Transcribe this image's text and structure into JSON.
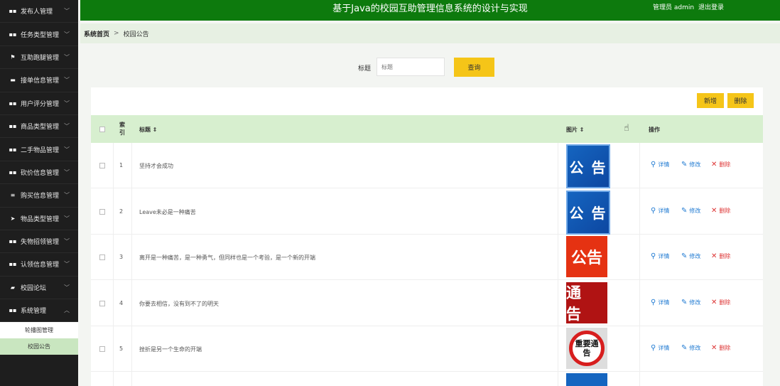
{
  "header": {
    "title": "基于Java的校园互助管理信息系统的设计与实现",
    "user": "管理员 admin",
    "logout": "退出登录"
  },
  "sidebar": {
    "items": [
      {
        "label": "发布人管理",
        "icon": "grid-icon",
        "glyph": "▪▪"
      },
      {
        "label": "任务类型管理",
        "icon": "grid-icon",
        "glyph": "▪▪"
      },
      {
        "label": "互助跑腿管理",
        "icon": "flag-icon",
        "glyph": "⚑"
      },
      {
        "label": "接单信息管理",
        "icon": "ticket-icon",
        "glyph": "▬"
      },
      {
        "label": "用户评分管理",
        "icon": "grid-icon",
        "glyph": "▪▪"
      },
      {
        "label": "商品类型管理",
        "icon": "grid-icon",
        "glyph": "▪▪"
      },
      {
        "label": "二手物品管理",
        "icon": "grid-icon",
        "glyph": "▪▪"
      },
      {
        "label": "砍价信息管理",
        "icon": "grid-icon",
        "glyph": "▪▪"
      },
      {
        "label": "购买信息管理",
        "icon": "list-icon",
        "glyph": "≡"
      },
      {
        "label": "物品类型管理",
        "icon": "send-icon",
        "glyph": "➤"
      },
      {
        "label": "失物招领管理",
        "icon": "grid-icon",
        "glyph": "▪▪"
      },
      {
        "label": "认领信息管理",
        "icon": "grid-icon",
        "glyph": "▪▪"
      },
      {
        "label": "校园论坛",
        "icon": "chat-icon",
        "glyph": "▰"
      },
      {
        "label": "系统管理",
        "icon": "grid-icon",
        "glyph": "▪▪",
        "expanded": true
      }
    ],
    "sub_items": [
      {
        "label": "轮播图管理"
      },
      {
        "label": "校园公告",
        "active": true
      }
    ]
  },
  "breadcrumb": {
    "home": "系统首页",
    "separator": ">",
    "current": "校园公告"
  },
  "search": {
    "label": "标题",
    "placeholder": "标题",
    "button": "查询"
  },
  "toolbar": {
    "add": "新增",
    "delete": "删除"
  },
  "table": {
    "headers": {
      "index": "索引",
      "title": "标题 ⇕",
      "image": "图片 ⇕",
      "actions": "操作"
    },
    "rows": [
      {
        "index": "1",
        "title": "坚持才会成功",
        "image_text": "公 告",
        "image_style": "blue"
      },
      {
        "index": "2",
        "title": "Leave未必是一种痛苦",
        "image_text": "公 告",
        "image_style": "blue"
      },
      {
        "index": "3",
        "title": "离开是一种痛苦，是一种勇气，但同样也是一个考验，是一个新的开端",
        "image_text": "公告",
        "image_style": "red"
      },
      {
        "index": "4",
        "title": "你要去相信，没有到不了的明天",
        "image_text": "通 告",
        "image_style": "darkred"
      },
      {
        "index": "5",
        "title": "挫折是另一个生命的开端",
        "image_text": "重要通告",
        "image_style": "badge"
      }
    ],
    "actions": {
      "detail": "详情",
      "edit": "修改",
      "delete": "删除"
    }
  },
  "colors": {
    "header_green": "#0d7a0d",
    "accent_yellow": "#f5c518",
    "row_header_green": "#d7efcf",
    "link_blue": "#1f7ad2",
    "delete_red": "#d33333"
  }
}
